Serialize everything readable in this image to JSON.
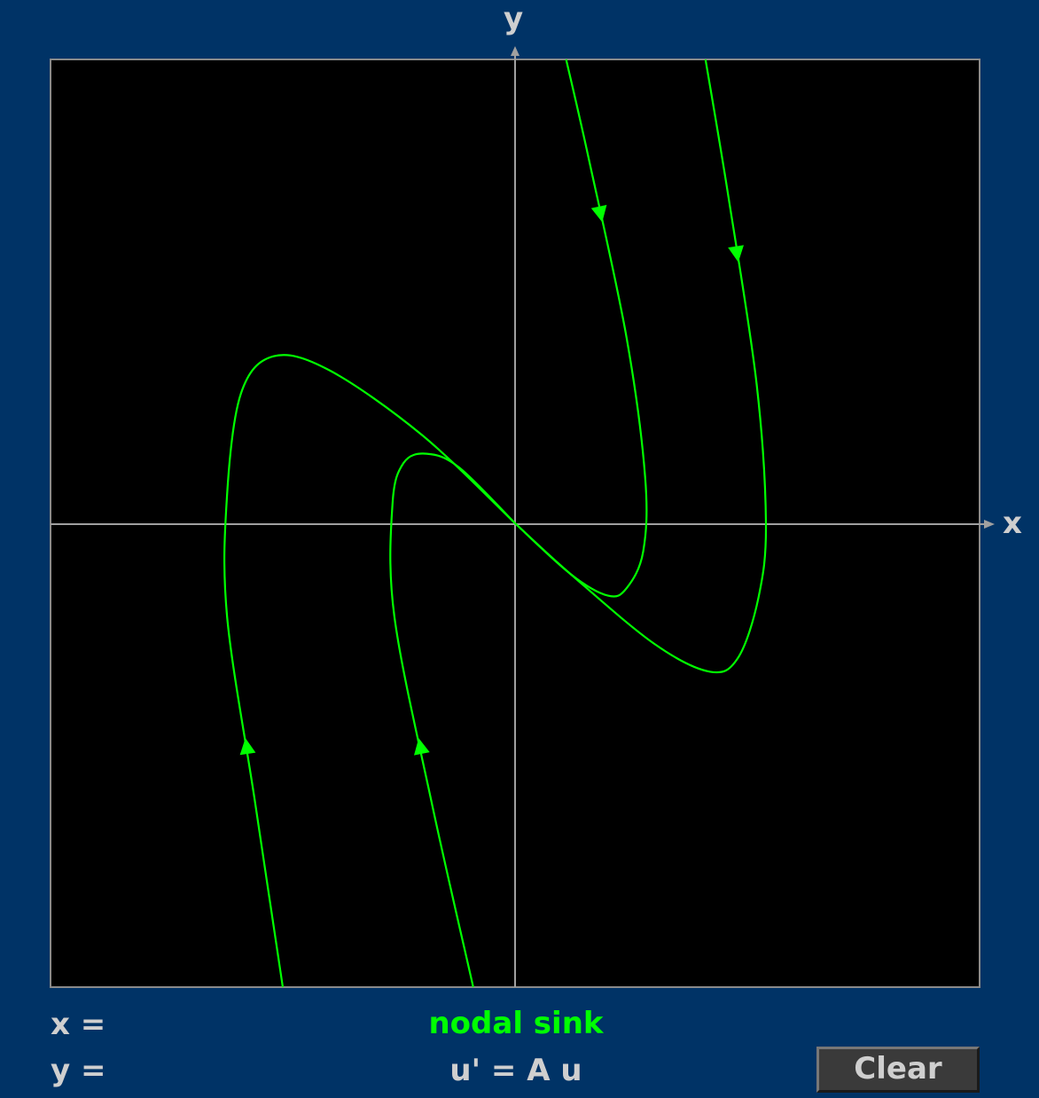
{
  "axes": {
    "x_label": "x",
    "y_label": "y"
  },
  "readout": {
    "x": "x =",
    "y": "y ="
  },
  "classification": "nodal sink",
  "equation": "u' = A u",
  "clear_label": "Clear",
  "colors": {
    "background": "#003366",
    "plot_background": "#000000",
    "trajectory": "#00ff00",
    "axis": "#a0a0a0",
    "text": "#cfcfcf"
  },
  "chart_data": {
    "type": "line",
    "xlabel": "x",
    "ylabel": "y",
    "xlim": [
      -5,
      5
    ],
    "ylim": [
      -5,
      5
    ],
    "grid": false,
    "series": [
      {
        "values": [
          [
            0.55,
            5.0
          ],
          [
            0.8,
            3.9
          ],
          [
            1.2,
            2.0
          ],
          [
            1.4,
            0.5
          ],
          [
            1.38,
            -0.3
          ],
          [
            1.2,
            -0.7
          ],
          [
            1.0,
            -0.78
          ],
          [
            0.6,
            -0.55
          ],
          [
            0,
            0
          ]
        ]
      },
      {
        "values": [
          [
            2.05,
            5.0
          ],
          [
            2.3,
            3.5
          ],
          [
            2.6,
            1.5
          ],
          [
            2.7,
            0
          ],
          [
            2.62,
            -0.8
          ],
          [
            2.4,
            -1.45
          ],
          [
            2.1,
            -1.6
          ],
          [
            1.5,
            -1.3
          ],
          [
            0.6,
            -0.55
          ],
          [
            0,
            0
          ]
        ]
      },
      {
        "values": [
          [
            -2.5,
            -5.0
          ],
          [
            -2.8,
            -3.0
          ],
          [
            -3.1,
            -1.0
          ],
          [
            -3.1,
            0.3
          ],
          [
            -2.95,
            1.4
          ],
          [
            -2.6,
            1.8
          ],
          [
            -2.0,
            1.65
          ],
          [
            -1.0,
            0.95
          ],
          [
            0,
            0
          ]
        ]
      },
      {
        "values": [
          [
            -0.45,
            -5.0
          ],
          [
            -0.9,
            -3.0
          ],
          [
            -1.3,
            -1.0
          ],
          [
            -1.32,
            0.2
          ],
          [
            -1.2,
            0.65
          ],
          [
            -0.95,
            0.75
          ],
          [
            -0.6,
            0.6
          ],
          [
            0,
            0
          ]
        ]
      }
    ]
  }
}
